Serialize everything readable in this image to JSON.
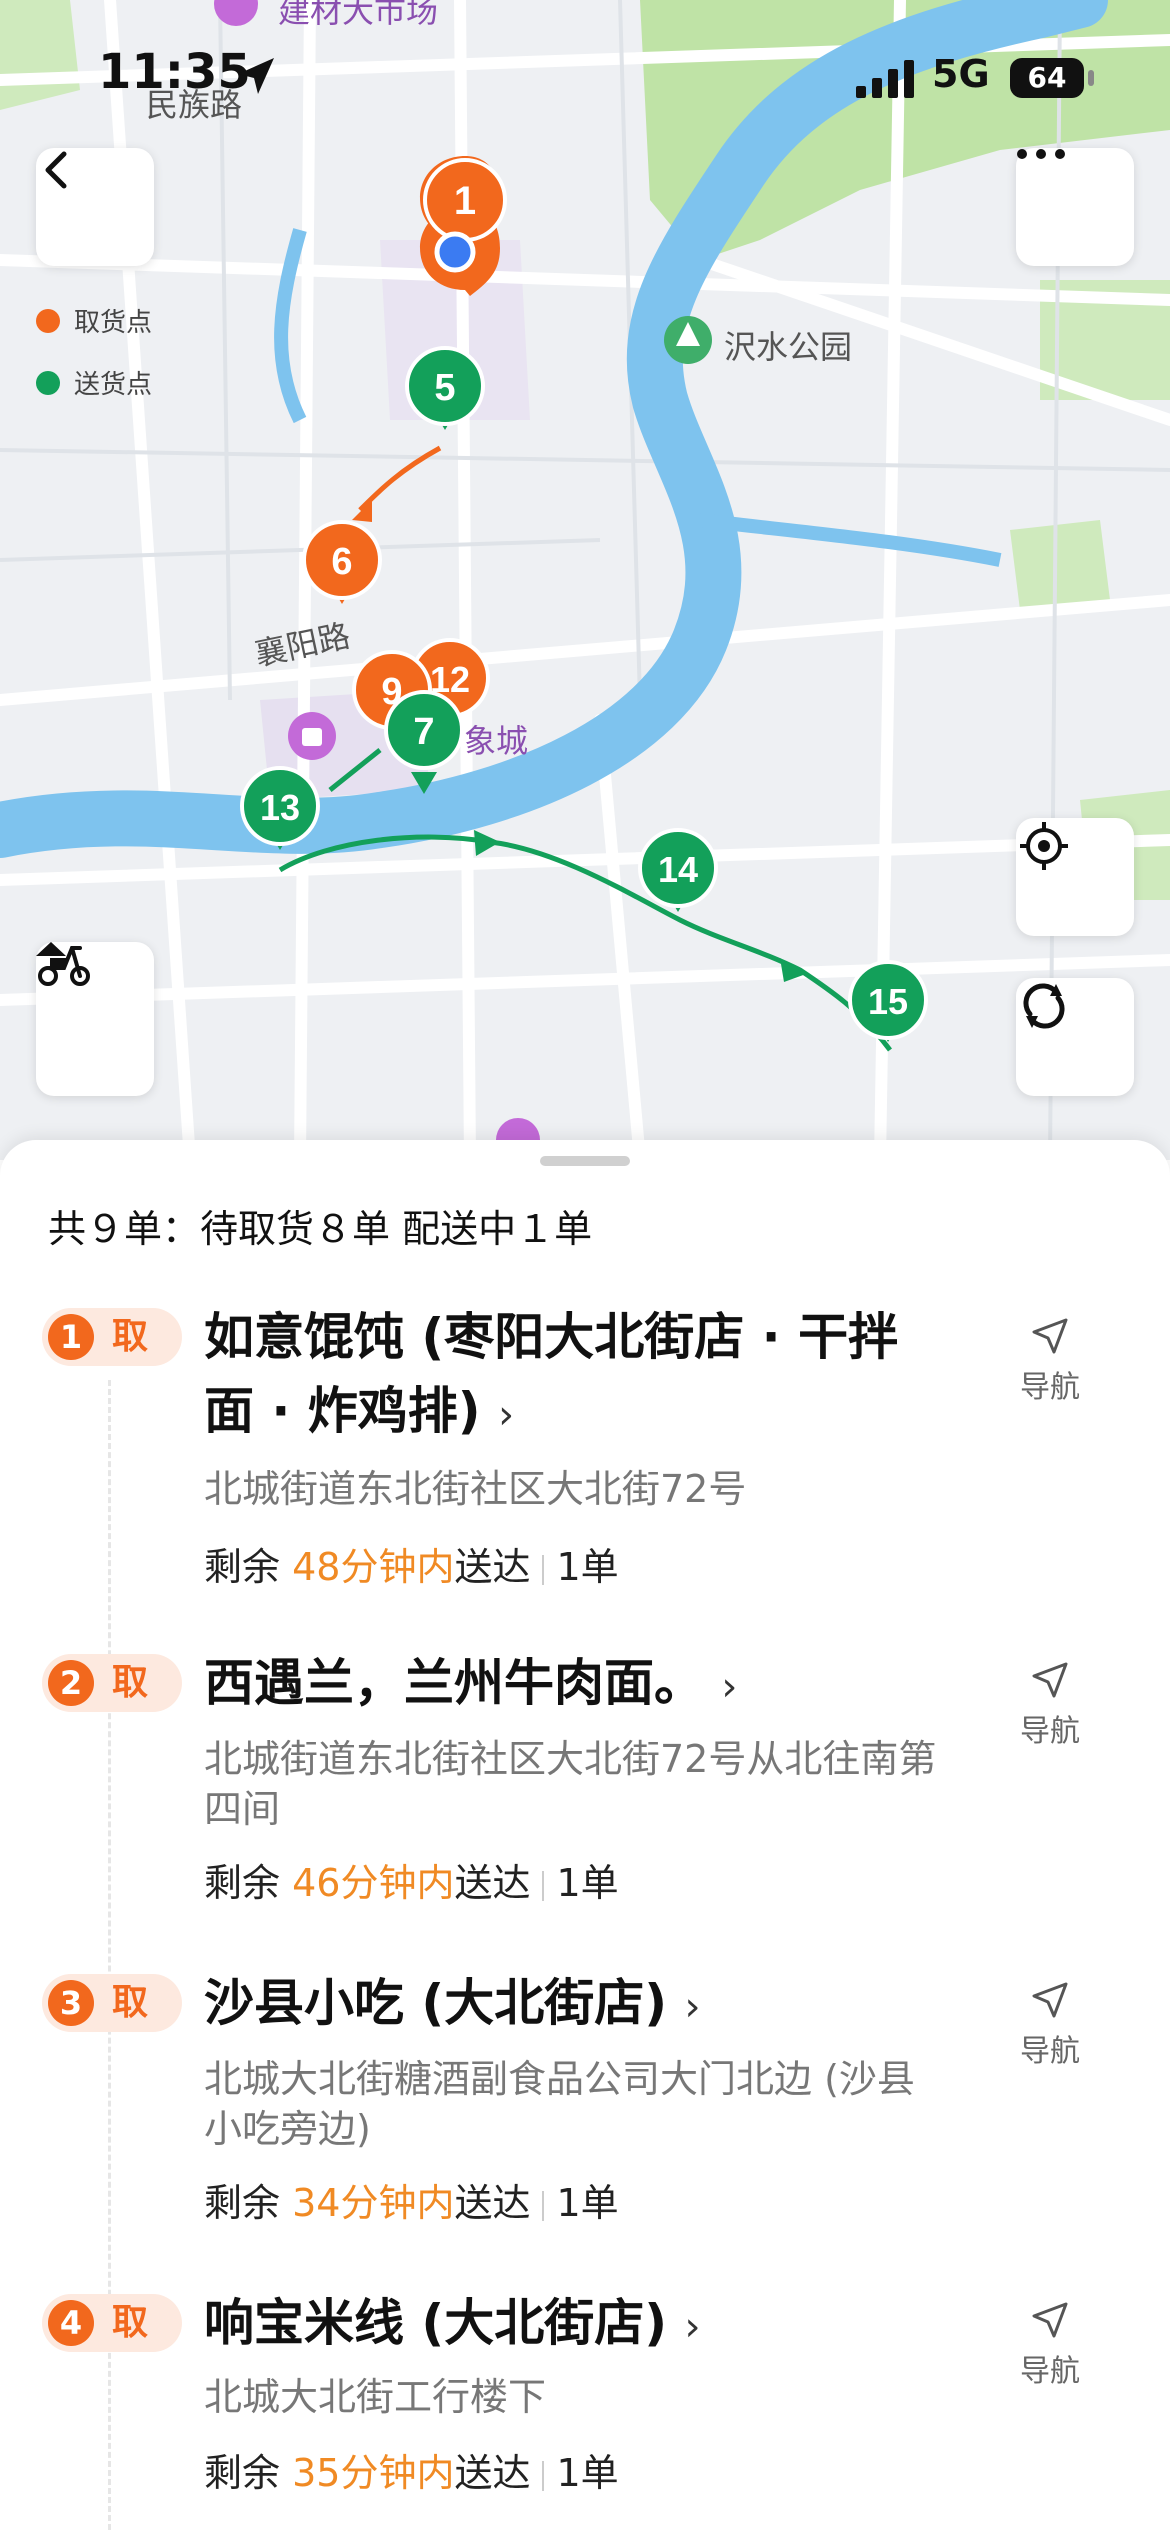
{
  "status_bar": {
    "time": "11:35",
    "network": "5G",
    "battery": "64"
  },
  "map": {
    "legend": {
      "pickup": "取货点",
      "delivery": "送货点"
    },
    "labels": {
      "top_poi": "建材大市场",
      "road_minzu": "民族路",
      "park": "沢水公园",
      "road_xiangyang": "襄阳路",
      "mall_suffix": "象城"
    },
    "markers": [
      "1",
      "5",
      "6",
      "9",
      "12",
      "7",
      "13",
      "14",
      "15"
    ],
    "colors": {
      "pickup": "#f2681d",
      "delivery": "#13a05a",
      "river": "#7ec3ee",
      "park": "#bfe3a6"
    }
  },
  "controls": {
    "back_icon": "back-chevron-icon",
    "more_icon": "more-dots-icon",
    "locate_icon": "locate-icon",
    "refresh_icon": "refresh-icon",
    "vehicle_icon": "scooter-icon"
  },
  "sheet": {
    "summary": "共９单：待取货８单 配送中１单",
    "nav_label": "导航",
    "items": [
      {
        "num": "1",
        "tag": "取",
        "name": "如意馄饨 (枣阳大北街店 · 干拌面 · 炸鸡排)",
        "address": "北城街道东北街社区大北街72号",
        "remain_prefix": "剩余",
        "remain_time": "48分钟内",
        "remain_suffix": "送达",
        "count": "1单"
      },
      {
        "num": "2",
        "tag": "取",
        "name": "西遇兰，兰州牛肉面。",
        "address": "北城街道东北街社区大北街72号从北往南第四间",
        "remain_prefix": "剩余",
        "remain_time": "46分钟内",
        "remain_suffix": "送达",
        "count": "1单"
      },
      {
        "num": "3",
        "tag": "取",
        "name": "沙县小吃 (大北街店)",
        "address": "北城大北街糖酒副食品公司大门北边 (沙县小吃旁边)",
        "remain_prefix": "剩余",
        "remain_time": "34分钟内",
        "remain_suffix": "送达",
        "count": "1单"
      },
      {
        "num": "4",
        "tag": "取",
        "name": "响宝米线 (大北街店)",
        "address": "北城大北街工行楼下",
        "remain_prefix": "剩余",
        "remain_time": "35分钟内",
        "remain_suffix": "送达",
        "count": "1单"
      }
    ]
  }
}
